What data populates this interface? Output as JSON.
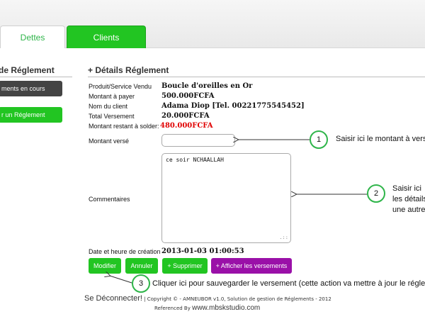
{
  "tabs": [
    {
      "label": "Dettes",
      "active": true
    },
    {
      "label": "Clients",
      "active": false
    }
  ],
  "left_panel": {
    "title": "de Réglement",
    "btn_en_cours": "ments en cours",
    "btn_reglement": "r un Réglement"
  },
  "main": {
    "title": "+ Détails Réglement",
    "fields": [
      {
        "label": "Produit/Service Vendu",
        "value": "Boucle d'oreilles en Or"
      },
      {
        "label": "Montant à payer",
        "value": "500.000FCFA"
      },
      {
        "label": "Nom du client",
        "value": "Adama Diop [Tel. 00221775545452]"
      },
      {
        "label": "Total Versement",
        "value": "20.000FCFA"
      },
      {
        "label": "Montant restant à solder:",
        "value": "480.000FCFA"
      }
    ],
    "montant_verse_label": "Montant versé",
    "montant_verse_value": "",
    "commentaires_label": "Commentaires",
    "commentaires_value": "ce soir NCHAALLAH",
    "date_label": "Date et heure de création",
    "date_value": "2013-01-03 01:00:53"
  },
  "buttons": {
    "modifier": "Modifier",
    "annuler": "Annuler",
    "supprimer": "+ Supprimer",
    "afficher": "+ Afficher les versements"
  },
  "callouts": [
    {
      "num": "1",
      "text": "Saisir ici le montant à versé"
    },
    {
      "num": "2",
      "text_lines": [
        "Saisir ici",
        "les détails",
        "une autre"
      ]
    },
    {
      "num": "3",
      "text": "Cliquer ici pour sauvegarder le versement (cette action va mettre à jour le réglement"
    }
  ],
  "footer": {
    "logout": "Se Déconnecter!",
    "copyright": " | Copyright © - AMNEUBOR v1.0, Solution de gestion de Réglements - 2012",
    "referenced": "Referenced By ",
    "site": "www.mbskstudio.com"
  },
  "colors": {
    "green": "#22c522",
    "purple": "#9a10a8",
    "red": "#e00000",
    "dark": "#444444"
  }
}
